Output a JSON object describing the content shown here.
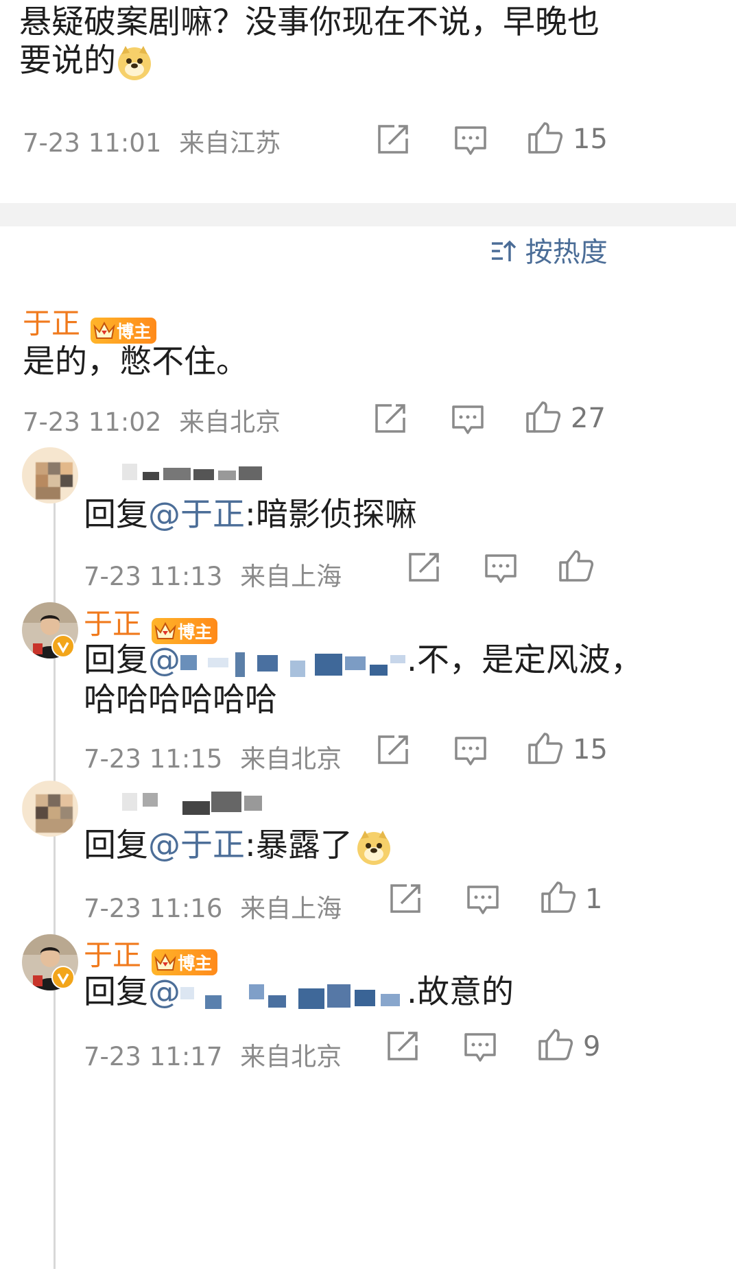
{
  "top_comment": {
    "line1": "悬疑破案剧嘛？没事你现在不说，早晚也",
    "line2": "要说的",
    "emoji": "doge-emoji",
    "time": "7-23 11:01",
    "location": "来自江苏",
    "likes": "15"
  },
  "sort": {
    "label": "按热度",
    "icon": "sort-icon"
  },
  "main_reply": {
    "name": "于正",
    "badge": "博主",
    "text": "是的，憋不住。",
    "time": "7-23 11:02",
    "location": "来自北京",
    "likes": "27"
  },
  "replies": [
    {
      "prefix": "回复",
      "mention": "@于正",
      "body": ":暗影侦探嘛",
      "time": "7-23 11:13",
      "location": "来自上海",
      "likes": ""
    },
    {
      "name": "于正",
      "badge": "博主",
      "prefix": "回复",
      "mention": "@",
      "body": ".不，是定风波，",
      "body2": "哈哈哈哈哈哈",
      "time": "7-23 11:15",
      "location": "来自北京",
      "likes": "15"
    },
    {
      "prefix": "回复",
      "mention": "@于正",
      "body": ":暴露了",
      "time": "7-23 11:16",
      "location": "来自上海",
      "likes": "1"
    },
    {
      "name": "于正",
      "badge": "博主",
      "prefix": "回复",
      "mention": "@",
      "body": ".故意的",
      "time": "7-23 11:17",
      "location": "来自北京",
      "likes": "9"
    }
  ],
  "colors": {
    "name": "#f07a1d",
    "mention": "#4c6e98",
    "meta": "#8a8a8a"
  }
}
